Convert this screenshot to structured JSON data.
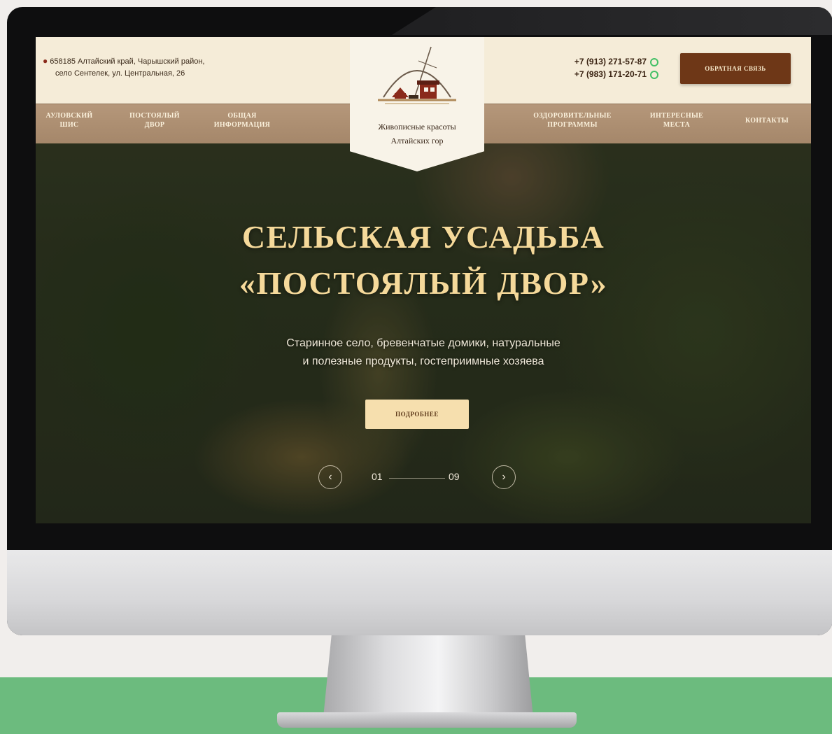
{
  "header": {
    "address_line1": "658185 Алтайский край, Чарышский район,",
    "address_line2": "село Сентелек, ул. Центральная, 26",
    "phone1": "+7 (913) 271-57-87",
    "phone2": "+7 (983) 171-20-71",
    "feedback_button": "ОБРАТНАЯ СВЯЗЬ"
  },
  "logo": {
    "caption_line1": "Живописные красоты",
    "caption_line2": "Алтайских гор"
  },
  "nav": {
    "items": [
      {
        "line1": "АУЛОВСКИЙ",
        "line2": "ШИС"
      },
      {
        "line1": "ПОСТОЯЛЫЙ",
        "line2": "ДВОР"
      },
      {
        "line1": "ОБЩАЯ",
        "line2": "ИНФОРМАЦИЯ"
      },
      {
        "line1": "ОЗДОРОВИТЕЛЬНЫЕ",
        "line2": "ПРОГРАММЫ"
      },
      {
        "line1": "ИНТЕРЕСНЫЕ",
        "line2": "МЕСТА"
      },
      {
        "line1": "КОНТАКТЫ",
        "line2": ""
      }
    ]
  },
  "hero": {
    "title_line1": "СЕЛЬСКАЯ УСАДЬБА",
    "title_line2": "«ПОСТОЯЛЫЙ ДВОР»",
    "subtitle_line1": "Старинное село, бревенчатые домики, натуральные",
    "subtitle_line2": "и полезные продукты, гостеприимные хозяева",
    "button": "ПОДРОБНЕЕ"
  },
  "slider": {
    "current": "01",
    "total": "09"
  },
  "colors": {
    "accent_brown": "#6e3717",
    "header_cream": "#f5ecd8",
    "nav_tan": "#a5876a",
    "title_gold": "#f5d99a",
    "whatsapp_green": "#43c066",
    "page_band_green": "#6cbb7e"
  }
}
